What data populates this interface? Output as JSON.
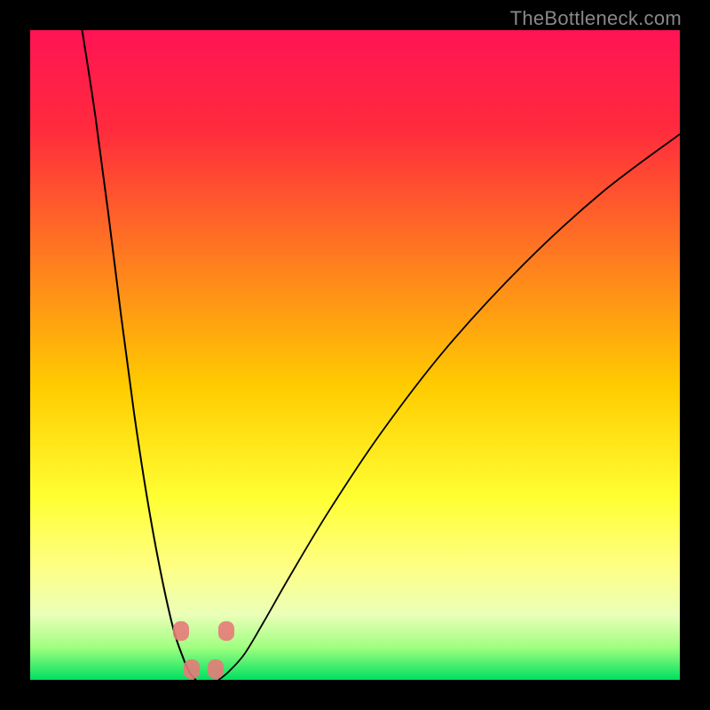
{
  "watermark": "TheBottleneck.com",
  "chart_data": {
    "type": "line",
    "title": "",
    "xlabel": "",
    "ylabel": "",
    "xlim": [
      0,
      100
    ],
    "ylim": [
      0,
      100
    ],
    "gradient_stops": [
      {
        "offset": 0.0,
        "color": "#ff1454"
      },
      {
        "offset": 0.15,
        "color": "#ff2a3d"
      },
      {
        "offset": 0.35,
        "color": "#ff7b20"
      },
      {
        "offset": 0.55,
        "color": "#ffcc00"
      },
      {
        "offset": 0.72,
        "color": "#ffff33"
      },
      {
        "offset": 0.82,
        "color": "#ffff80"
      },
      {
        "offset": 0.9,
        "color": "#eaffb8"
      },
      {
        "offset": 0.95,
        "color": "#a0ff80"
      },
      {
        "offset": 1.0,
        "color": "#00e060"
      }
    ],
    "series": [
      {
        "name": "left-descending-curve",
        "x": [
          8,
          10,
          12,
          14,
          16,
          18,
          20,
          22,
          23.5,
          24.5,
          25.5
        ],
        "y": [
          100,
          87,
          72,
          56,
          41,
          28,
          17,
          8,
          3.5,
          1.2,
          0
        ]
      },
      {
        "name": "right-ascending-curve",
        "x": [
          29,
          30.5,
          33,
          36,
          40,
          46,
          54,
          64,
          76,
          88,
          100
        ],
        "y": [
          0,
          1.2,
          4,
          9,
          16,
          26,
          38,
          51,
          64,
          75,
          84
        ]
      }
    ],
    "markers": [
      {
        "x": 23.2,
        "y": 7.5,
        "color": "#e77a7a"
      },
      {
        "x": 24.8,
        "y": 1.6,
        "color": "#e77a7a"
      },
      {
        "x": 28.6,
        "y": 1.6,
        "color": "#e77a7a"
      },
      {
        "x": 30.2,
        "y": 7.5,
        "color": "#e77a7a"
      }
    ]
  }
}
